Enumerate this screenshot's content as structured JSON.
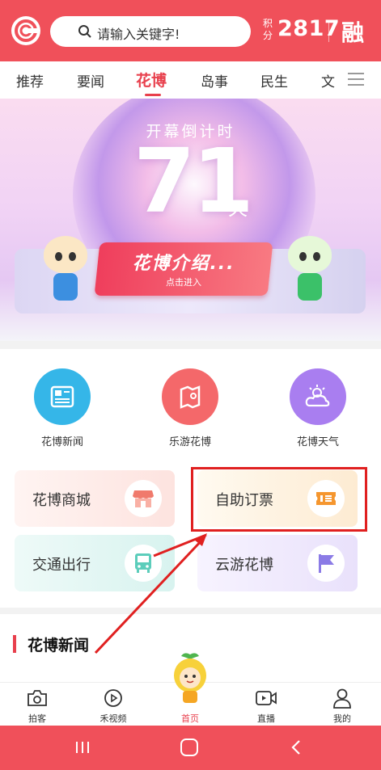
{
  "header": {
    "search_placeholder": "请输入关键字!",
    "score_label": "积分",
    "score_value": "2817",
    "rong_label": "融",
    "accent": "#f0505a"
  },
  "nav": {
    "tabs": [
      "推荐",
      "要闻",
      "花博",
      "岛事",
      "民生",
      "文"
    ],
    "active": "花博"
  },
  "banner": {
    "countdown_title": "开幕倒计时",
    "countdown_number": "71",
    "countdown_unit": "天",
    "intro_title": "花博介绍...",
    "intro_sub": "点击进入"
  },
  "services": [
    {
      "label": "花博新闻",
      "icon": "newspaper-icon",
      "color": "#35b6e8"
    },
    {
      "label": "乐游花博",
      "icon": "map-icon",
      "color": "#f4686a"
    },
    {
      "label": "花博天气",
      "icon": "weather-icon",
      "color": "#a97ef0"
    }
  ],
  "cards": [
    {
      "label": "花博商城",
      "icon": "shop-icon"
    },
    {
      "label": "自助订票",
      "icon": "ticket-icon"
    },
    {
      "label": "交通出行",
      "icon": "bus-icon"
    },
    {
      "label": "云游花博",
      "icon": "flag-icon"
    }
  ],
  "news": {
    "title": "花博新闻"
  },
  "tabbar": [
    {
      "label": "拍客",
      "icon": "camera-icon"
    },
    {
      "label": "禾视频",
      "icon": "play-icon"
    },
    {
      "label": "首页",
      "icon": "mascot-icon",
      "active": true
    },
    {
      "label": "直播",
      "icon": "video-icon"
    },
    {
      "label": "我的",
      "icon": "user-icon"
    }
  ]
}
